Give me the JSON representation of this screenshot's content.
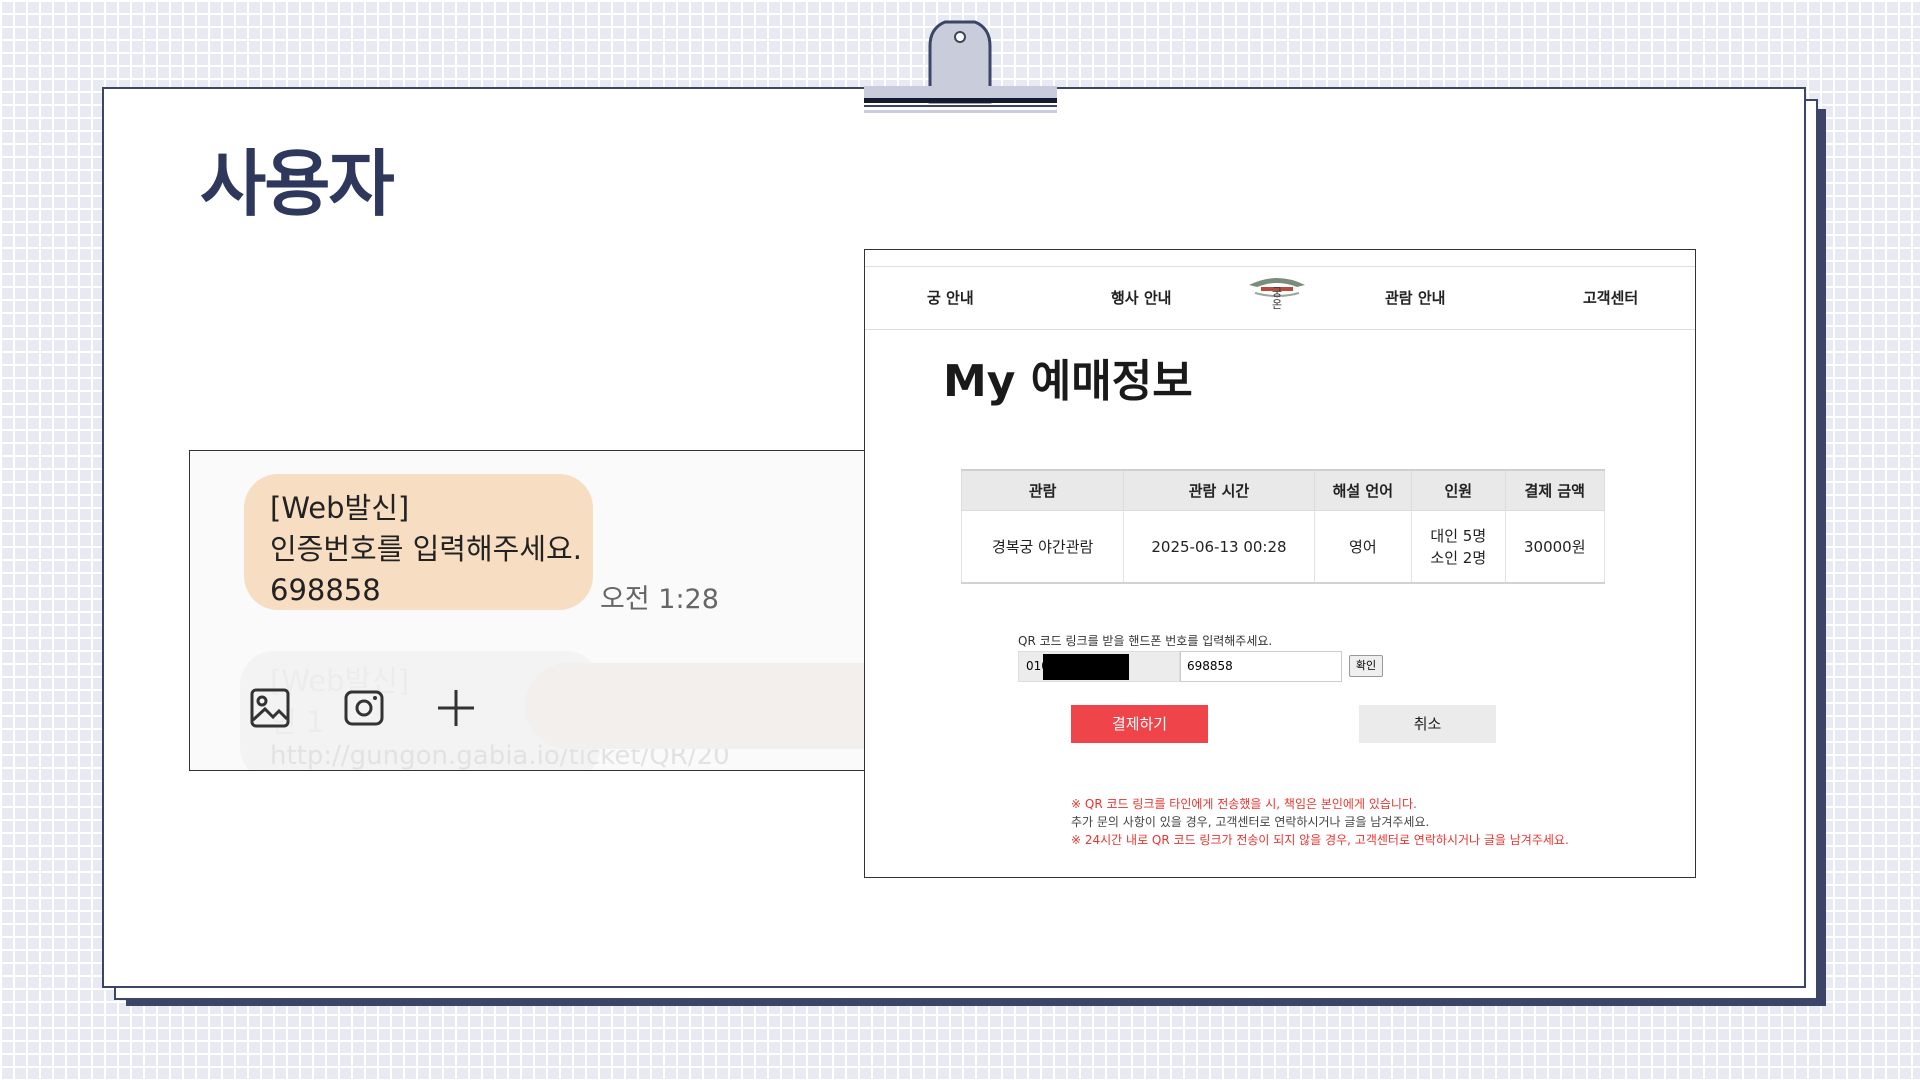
{
  "slide": {
    "title": "사용자"
  },
  "sms": {
    "lines": [
      "[Web발신]",
      "인증번호를 입력해주세요.",
      "698858"
    ],
    "time": "오전 1:28",
    "ghost_lines": [
      "[Web발신]",
      "인 1"
    ],
    "ghost_link": "http://gungon.gabia.io/ticket/QR/20",
    "icons": [
      "gallery-icon",
      "camera-icon",
      "plus-icon"
    ]
  },
  "web": {
    "nav": [
      "궁 안내",
      "행사 안내",
      "관람 안내",
      "고객센터"
    ],
    "logo_text": "궁온",
    "page_title": "My 예매정보",
    "table": {
      "headers": [
        "관람",
        "관람 시간",
        "해설 언어",
        "인원",
        "결제 금액"
      ],
      "row": {
        "tour": "경복궁 야간관람",
        "time": "2025-06-13 00:28",
        "language": "영어",
        "adults": "대인 5명",
        "children": "소인 2명",
        "price": "30000원"
      }
    },
    "qr_label": "QR 코드 링크를 받을 핸드폰 번호를 입력해주세요.",
    "phone_prefix": "010",
    "code_value": "698858",
    "confirm_label": "확인",
    "pay_label": "결제하기",
    "cancel_label": "취소",
    "notes": [
      "※ QR 코드 링크를 타인에게 전송했을 시, 책임은 본인에게 있습니다.",
      "추가 문의 사항이 있을 경우, 고객센터로 연락하시거나 글을 남겨주세요.",
      "※ 24시간 내로 QR 코드 링크가 전송이 되지 않을 경우, 고객센터로 연락하시거나 글을 남겨주세요."
    ]
  },
  "colors": {
    "accent": "#2e375c",
    "bubble": "#f7dec3",
    "pay": "#f0444b",
    "note_red": "#e8352f"
  }
}
